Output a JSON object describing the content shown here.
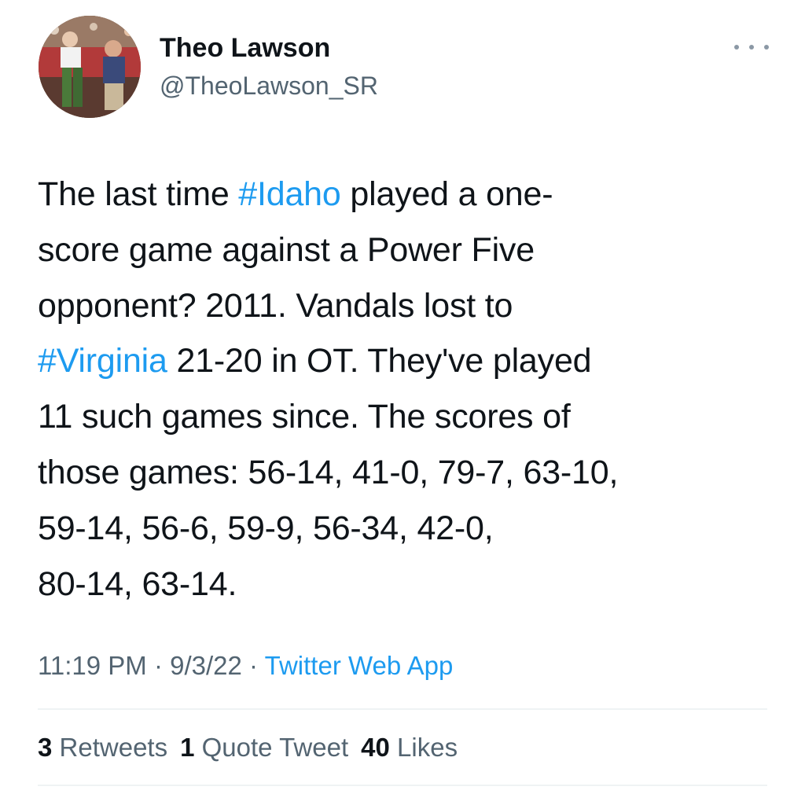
{
  "author": {
    "display_name": "Theo Lawson",
    "handle": "@TheoLawson_SR"
  },
  "tweet": {
    "lines": [
      [
        {
          "text": "The last time "
        },
        {
          "text": "#Idaho",
          "hashtag": true
        },
        {
          "text": " played a one-"
        }
      ],
      [
        {
          "text": "score game against a Power Five"
        }
      ],
      [
        {
          "text": "opponent? 2011. Vandals lost to"
        }
      ],
      [
        {
          "text": "#Virginia",
          "hashtag": true
        },
        {
          "text": " 21-20 in OT. They've played"
        }
      ],
      [
        {
          "text": "11 such games since. The scores of"
        }
      ],
      [
        {
          "text": "those games: 56-14, 41-0, 79-7, 63-10,"
        }
      ],
      [
        {
          "text": "59-14, 56-6, 59-9, 56-34, 42-0,"
        }
      ],
      [
        {
          "text": "80-14, 63-14."
        }
      ]
    ]
  },
  "meta": {
    "time": "11:19 PM",
    "separator": " · ",
    "date": "9/3/22",
    "source": "Twitter Web App"
  },
  "stats": {
    "retweets_count": "3",
    "retweets_label": "Retweets",
    "quotes_count": "1",
    "quotes_label": "Quote Tweet",
    "likes_count": "40",
    "likes_label": "Likes"
  },
  "colors": {
    "accent": "#1d9bf0",
    "text": "#0f1419",
    "secondary": "#536471",
    "divider": "#eff3f4"
  },
  "icons": {
    "more": "more-horizontal-icon"
  }
}
